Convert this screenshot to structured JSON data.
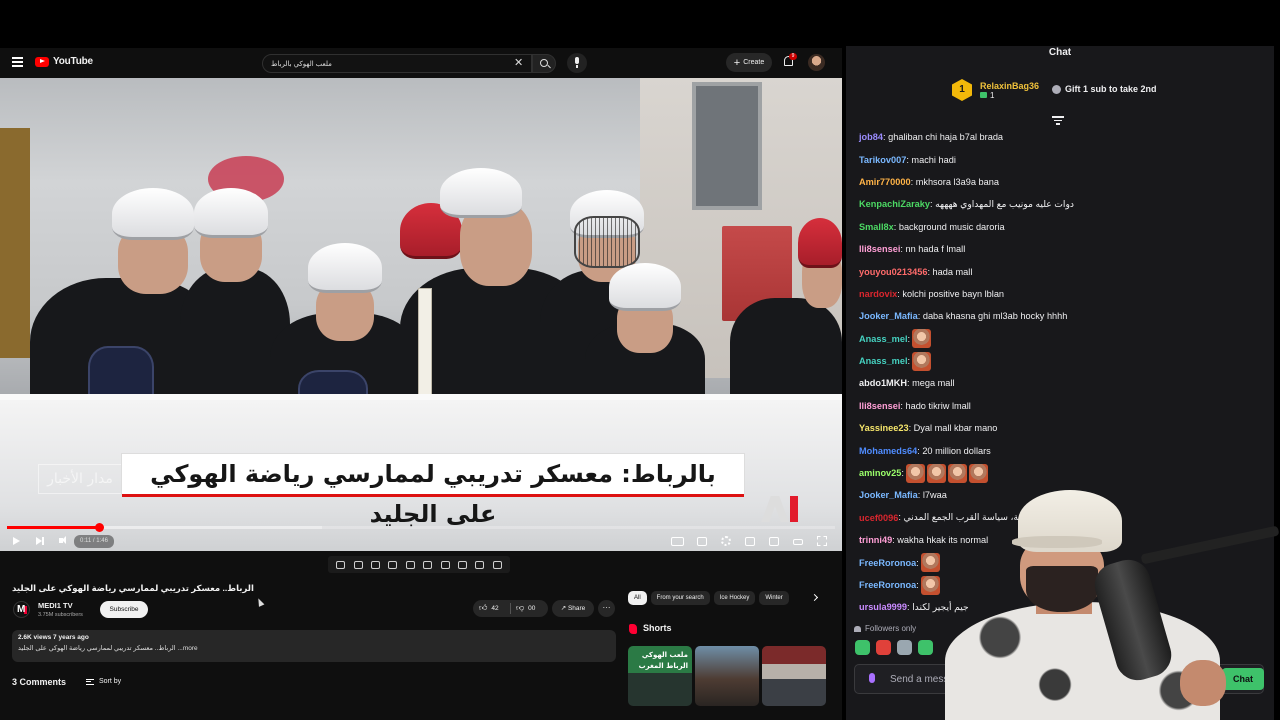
{
  "youtube": {
    "logo_text": "YouTube",
    "search_value": "ملعب الهوكي بالرباط",
    "create_label": "Create",
    "notif_count": "9",
    "video": {
      "lower_third": "بالرباط: معسكر تدريبي لممارسي رياضة الهوكي على الجليد",
      "channel_bug": "مدار الأخبار",
      "time": "0:11 / 1:46",
      "progress_played": 0.111,
      "progress_buffered": 0.38
    },
    "title": "الرباط.. معسكر تدريبي لممارسي رياضة الهوكي على الجليد",
    "channel": {
      "name": "MEDI1 TV",
      "subs": "3.75M subscribers",
      "subscribe_label": "Subscribe"
    },
    "likes": "42",
    "dislikes": "00",
    "share_label": "Share",
    "more_label": "···",
    "description": {
      "stats": "2.6K views  7 years ago",
      "text": "الرباط.. معسكر تدريبي لممارسي رياضة الهوكي على الجليد ...more"
    },
    "comments_label": "3 Comments",
    "sort_label": "Sort by",
    "chips": [
      "All",
      "From your search",
      "Ice Hockey",
      "Winter"
    ],
    "shorts_label": "Shorts",
    "short1_label": "ملعب الهوكي الرباط المغرب"
  },
  "chat": {
    "header": "Chat",
    "pinned_rank": "1",
    "pinned_user": "RelaxinBag36",
    "pinned_count": "1",
    "gift_text": "Gift 1 sub to take 2nd",
    "messages": [
      {
        "user": "job84",
        "color": "#9b8cff",
        "text": ": ghaliban chi haja b7al brada"
      },
      {
        "user": "Tarikov007",
        "color": "#7ab8ff",
        "text": ": machi hadi"
      },
      {
        "user": "Amir770000",
        "color": "#ffb347",
        "text": ": mkhsora l3a9a bana"
      },
      {
        "user": "KenpachiZaraky",
        "color": "#4cd964",
        "text": ": دوات عليه مونيب مع المهداوي ههههه"
      },
      {
        "user": "Small8x",
        "color": "#4cd964",
        "text": ": background music daroria"
      },
      {
        "user": "lli8sensei",
        "color": "#ff9fd6",
        "text": ": nn hada f lmall"
      },
      {
        "user": "youyou0213456",
        "color": "#ff6b6b",
        "text": ": hada mall"
      },
      {
        "user": "nardovix",
        "color": "#d9262e",
        "text": ": kolchi positive bayn lblan"
      },
      {
        "user": "Jooker_Mafia",
        "color": "#7ab8ff",
        "text": ": daba khasna ghi ml3ab hocky hhhh"
      },
      {
        "user": "Anass_mel",
        "color": "#45d1c0",
        "text": ":",
        "emotes": 1
      },
      {
        "user": "Anass_mel",
        "color": "#45d1c0",
        "text": ":",
        "emotes": 1
      },
      {
        "user": "abdo1MKH",
        "color": "#efeff1",
        "text": ": mega mall"
      },
      {
        "user": "lli8sensei",
        "color": "#ff9fd6",
        "text": ": hado tikriw lmall"
      },
      {
        "user": "Yassinee23",
        "color": "#f5e56b",
        "text": ": Dyal mall kbar mano"
      },
      {
        "user": "Mohameds64",
        "color": "#4f8cff",
        "text": ": 20 million dollars"
      },
      {
        "user": "aminov25",
        "color": "#9bff6b",
        "text": ":",
        "emotes": 4
      },
      {
        "user": "Jooker_Mafia",
        "color": "#7ab8ff",
        "text": ": l7waa"
      },
      {
        "user": "ucef0096",
        "color": "#d9262e",
        "text": ": التعاضدية، سياسة القرب الجمع المدني"
      },
      {
        "user": "trinni49",
        "color": "#ff9fd6",
        "text": ": wakha hkak its normal"
      },
      {
        "user": "FreeRoronoa",
        "color": "#7ab8ff",
        "text": ":",
        "emotes": 1
      },
      {
        "user": "FreeRoronoa",
        "color": "#7ab8ff",
        "text": ":",
        "emotes": 1
      },
      {
        "user": "ursula9999",
        "color": "#c98bff",
        "text": ": جيم أيجير لكندا"
      }
    ],
    "followers_only": "Followers only",
    "input_placeholder": "Send a message",
    "chat_button": "Chat"
  }
}
